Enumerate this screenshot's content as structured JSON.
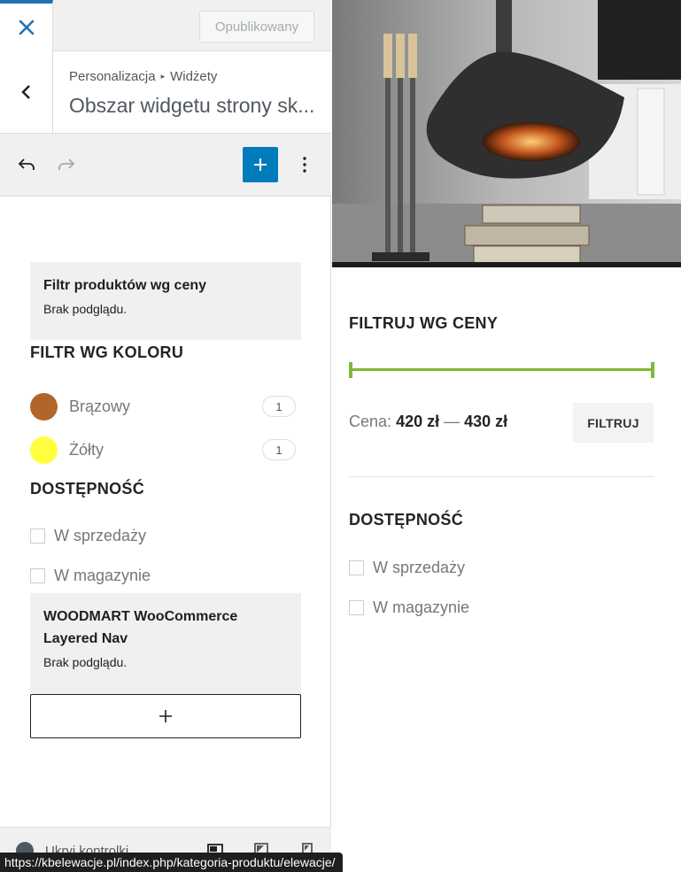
{
  "topbar": {
    "publish_label": "Opublikowany"
  },
  "section": {
    "breadcrumb_root": "Personalizacja",
    "breadcrumb_sep": "▸",
    "breadcrumb_current": "Widżety",
    "title": "Obszar widgetu strony sk..."
  },
  "editor": {
    "price_block": {
      "title": "Filtr produktów wg ceny",
      "subtitle": "Brak podglądu."
    },
    "color_widget": {
      "heading": "FILTR WG KOLORU",
      "items": [
        {
          "label": "Brązowy",
          "count": "1",
          "color": "#b0662a"
        },
        {
          "label": "Żółty",
          "count": "1",
          "color": "#ffff3f"
        }
      ]
    },
    "availability": {
      "heading": "DOSTĘPNOŚĆ",
      "items": [
        {
          "label": "W sprzedaży"
        },
        {
          "label": "W magazynie"
        }
      ]
    },
    "layered_block": {
      "title": "WOODMART WooCommerce Layered Nav",
      "subtitle": "Brak podglądu."
    }
  },
  "footer": {
    "collapse_label": "Ukryj kontrolki"
  },
  "preview": {
    "price_filter": {
      "heading": "FILTRUJ WG CENY",
      "price_prefix": "Cena:",
      "min_price": "420 zł",
      "dash": "—",
      "max_price": "430 zł",
      "button_label": "FILTRUJ",
      "accent": "#83b735"
    },
    "availability": {
      "heading": "DOSTĘPNOŚĆ",
      "items": [
        {
          "label": "W sprzedaży"
        },
        {
          "label": "W magazynie"
        }
      ]
    }
  },
  "status_bar": {
    "url": "https://kbelewacje.pl/index.php/kategoria-produktu/elewacje/"
  },
  "colors": {
    "wp_blue": "#007cba",
    "wp_accent_bar": "#2271b1"
  }
}
